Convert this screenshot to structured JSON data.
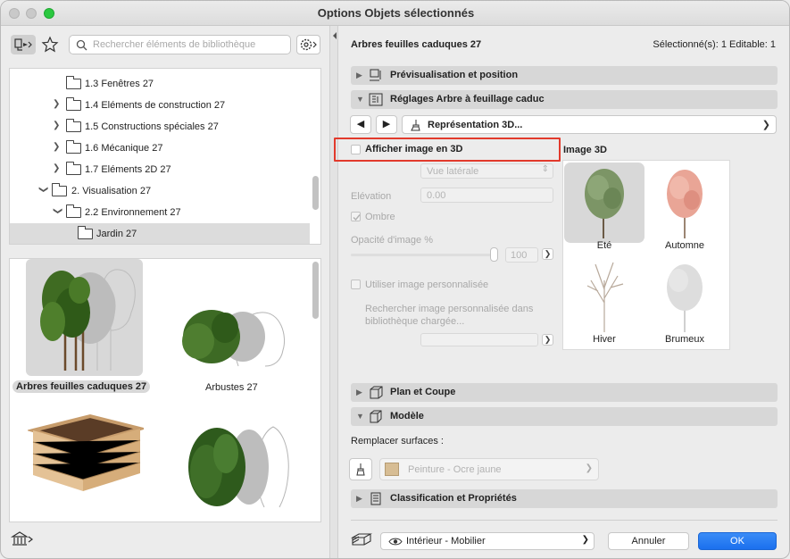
{
  "window": {
    "title": "Options Objets sélectionnés"
  },
  "library": {
    "search_placeholder": "Rechercher éléments de bibliothèque",
    "tree": [
      {
        "label": "1.3 Fenêtres 27",
        "expanded": false,
        "has_chevron": false
      },
      {
        "label": "1.4 Eléments de construction 27",
        "expanded": false,
        "has_chevron": true
      },
      {
        "label": "1.5 Constructions spéciales 27",
        "expanded": false,
        "has_chevron": true
      },
      {
        "label": "1.6 Mécanique 27",
        "expanded": false,
        "has_chevron": true
      },
      {
        "label": "1.7 Eléments 2D 27",
        "expanded": false,
        "has_chevron": true
      },
      {
        "label": "2. Visualisation 27",
        "expanded": true,
        "has_chevron": true
      },
      {
        "label": "2.2 Environnement 27",
        "expanded": true,
        "has_chevron": true
      },
      {
        "label": "Jardin 27",
        "expanded": false,
        "has_chevron": false,
        "selected": true
      }
    ],
    "gallery": [
      {
        "label": "Arbres feuilles caduques 27",
        "selected": true
      },
      {
        "label": "Arbustes 27",
        "selected": false
      },
      {
        "label": "",
        "selected": false
      },
      {
        "label": "",
        "selected": false
      }
    ]
  },
  "header": {
    "object_name": "Arbres feuilles caduques 27",
    "selection_info": "Sélectionné(s): 1 Editable: 1"
  },
  "sections": {
    "preview": "Prévisualisation et position",
    "settings": "Réglages Arbre à feuillage caduc",
    "plan": "Plan et Coupe",
    "model": "Modèle",
    "classification": "Classification et Propriétés"
  },
  "representation": {
    "value": "Représentation 3D..."
  },
  "image3d": {
    "checkbox_label": "Afficher image en 3D",
    "checked": false,
    "view_select": "Vue latérale",
    "elevation_label": "Elévation",
    "elevation_value": "0.00",
    "shadow_label": "Ombre",
    "shadow_checked": true,
    "opacity_label": "Opacité d'image %",
    "opacity_value": "100",
    "custom_image_label": "Utiliser image personnalisée",
    "search_custom_label": "Rechercher image personnalisée dans bibliothèque chargée...",
    "panel_title": "Image 3D",
    "seasons": [
      {
        "label": "Eté",
        "selected": true
      },
      {
        "label": "Automne",
        "selected": false
      },
      {
        "label": "Hiver",
        "selected": false
      },
      {
        "label": "Brumeux",
        "selected": false
      }
    ]
  },
  "model": {
    "replace_surfaces_label": "Remplacer surfaces :",
    "surface_value": "Peinture - Ocre jaune",
    "surface_color": "#d7bd94"
  },
  "footer": {
    "layer_value": "Intérieur - Mobilier",
    "cancel_label": "Annuler",
    "ok_label": "OK"
  },
  "colors": {
    "accent": "#1b70ee",
    "highlight": "#e23a2c"
  }
}
